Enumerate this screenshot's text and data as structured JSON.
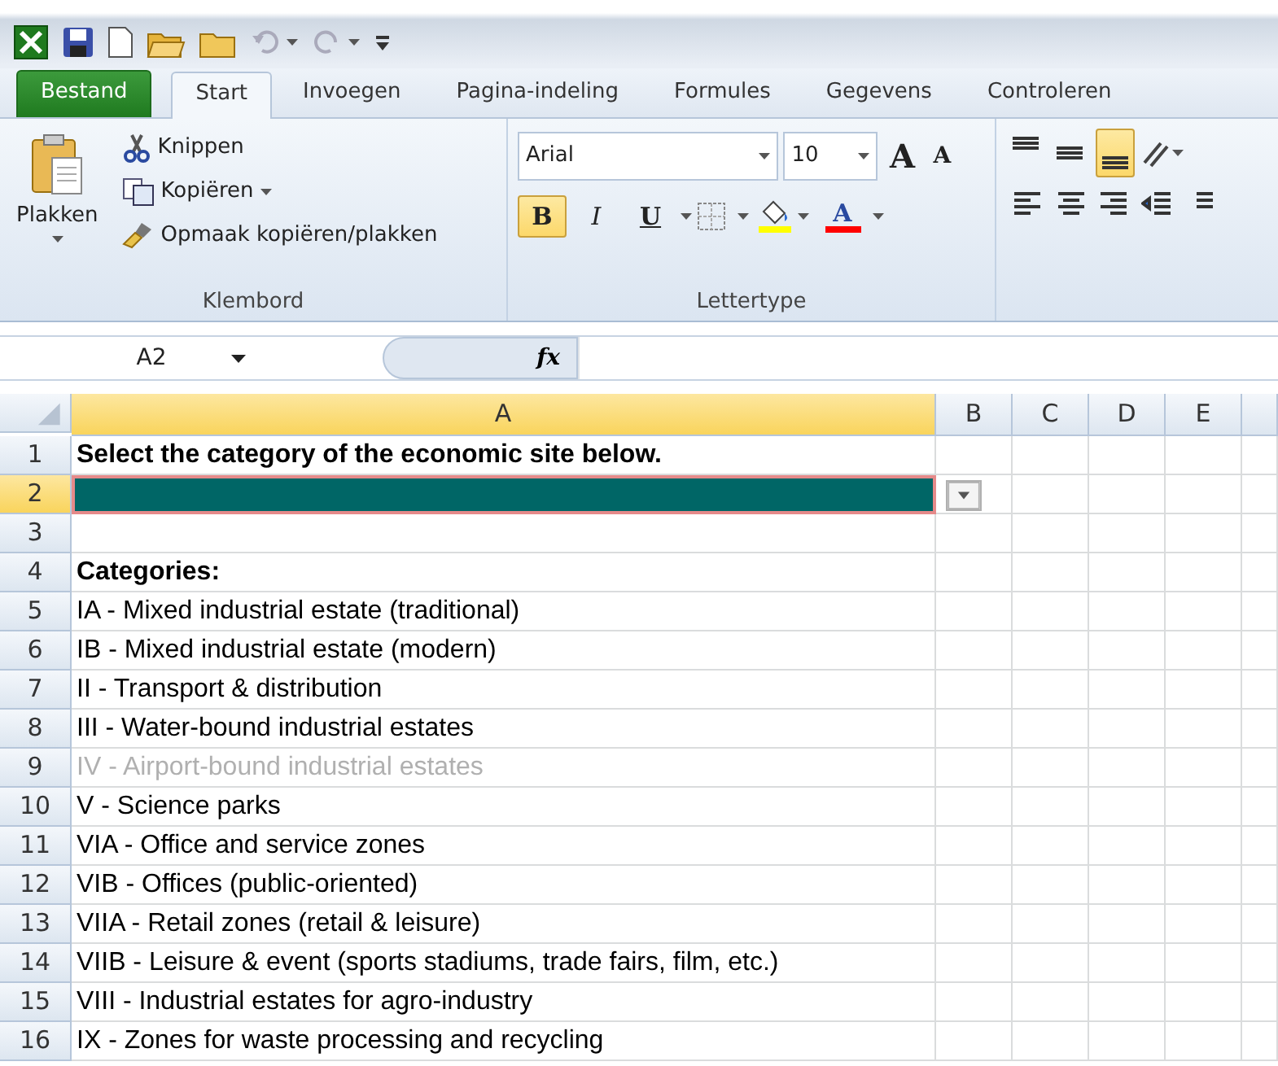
{
  "tabs": [
    {
      "label": "Bestand",
      "kind": "file",
      "selected": false
    },
    {
      "label": "Start",
      "kind": "tab",
      "selected": true
    },
    {
      "label": "Invoegen",
      "kind": "tab",
      "selected": false
    },
    {
      "label": "Pagina-indeling",
      "kind": "tab",
      "selected": false
    },
    {
      "label": "Formules",
      "kind": "tab",
      "selected": false
    },
    {
      "label": "Gegevens",
      "kind": "tab",
      "selected": false
    },
    {
      "label": "Controleren",
      "kind": "tab",
      "selected": false
    }
  ],
  "clipboard": {
    "paste": "Plakken",
    "cut": "Knippen",
    "copy": "Kopiëren",
    "format_painter": "Opmaak kopiëren/plakken",
    "group_label": "Klembord"
  },
  "font": {
    "font_name": "Arial",
    "font_size": "10",
    "grow": "A",
    "shrink": "A",
    "style_buttons": [
      {
        "label": "B",
        "kind": "bold",
        "selected": true
      },
      {
        "label": "I",
        "kind": "italic",
        "selected": false
      },
      {
        "label": "U",
        "kind": "underline",
        "selected": false
      }
    ],
    "font_color_label": "A",
    "group_label": "Lettertype"
  },
  "alignment": {
    "vertical": [
      {
        "kind": "top",
        "selected": false
      },
      {
        "kind": "middle",
        "selected": false
      },
      {
        "kind": "bottom",
        "selected": true
      }
    ]
  },
  "formula_bar": {
    "name_box": "A2",
    "fx": "fx"
  },
  "columns": [
    {
      "label": "A",
      "selected": true
    },
    {
      "label": "B",
      "selected": false
    },
    {
      "label": "C",
      "selected": false
    },
    {
      "label": "D",
      "selected": false
    },
    {
      "label": "E",
      "selected": false
    }
  ],
  "rows": [
    {
      "number": "1",
      "kind": "heading",
      "text": "Select the category of the economic site below.",
      "selected": false
    },
    {
      "number": "2",
      "kind": "input",
      "selected": true
    },
    {
      "number": "3",
      "kind": "blank",
      "selected": false
    },
    {
      "number": "4",
      "kind": "heading",
      "text": "Categories:",
      "selected": false
    },
    {
      "number": "5",
      "kind": "item",
      "text": "IA - Mixed industrial estate (traditional)",
      "selected": false
    },
    {
      "number": "6",
      "kind": "item",
      "text": "IB - Mixed industrial estate (modern)",
      "selected": false
    },
    {
      "number": "7",
      "kind": "item",
      "text": "II - Transport & distribution",
      "selected": false
    },
    {
      "number": "8",
      "kind": "item",
      "text": "III - Water-bound industrial estates",
      "selected": false
    },
    {
      "number": "9",
      "kind": "greyed",
      "text": "IV - Airport-bound industrial estates",
      "selected": false
    },
    {
      "number": "10",
      "kind": "item",
      "text": "V - Science parks",
      "selected": false
    },
    {
      "number": "11",
      "kind": "item",
      "text": "VIA - Office and service zones",
      "selected": false
    },
    {
      "number": "12",
      "kind": "item",
      "text": "VIB - Offices (public-oriented)",
      "selected": false
    },
    {
      "number": "13",
      "kind": "item",
      "text": "VIIA - Retail zones (retail & leisure)",
      "selected": false
    },
    {
      "number": "14",
      "kind": "item",
      "text": "VIIB - Leisure & event (sports stadiums, trade fairs, film, etc.)",
      "selected": false
    },
    {
      "number": "15",
      "kind": "item",
      "text": "VIII - Industrial estates for agro-industry",
      "selected": false
    },
    {
      "number": "16",
      "kind": "item",
      "text": "IX - Zones for waste processing and recycling",
      "selected": false
    }
  ]
}
